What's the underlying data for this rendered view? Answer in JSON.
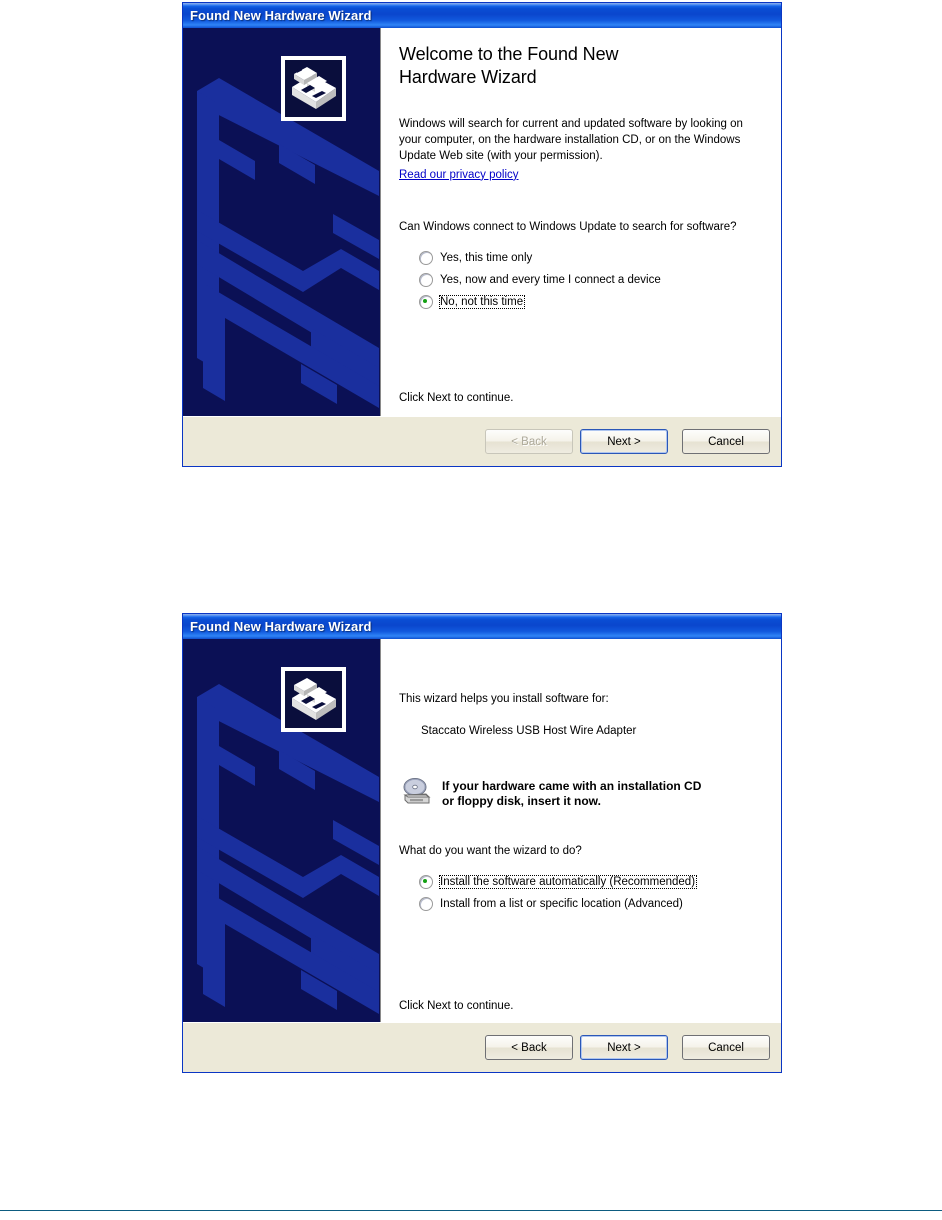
{
  "page": {
    "rule_color": "#0d5c80",
    "background": "#ffffff"
  },
  "dialogs": [
    {
      "id": "welcome-step",
      "title": "Found New Hardware Wizard",
      "icon": "hardware-device-icon",
      "heading": "Welcome to the Found New Hardware Wizard",
      "heading_line1": "Welcome to the Found New",
      "heading_line2": "Hardware Wizard",
      "intro": "Windows will search for current and updated software by looking on your computer, on the hardware installation CD, or on the Windows Update Web site (with your permission).",
      "privacy_link": "Read our privacy policy",
      "question": "Can Windows connect to Windows Update to search for software?",
      "options": [
        {
          "label": "Yes, this time only",
          "accel": "Y",
          "checked": false,
          "focused": false
        },
        {
          "label": "Yes, now and every time I connect a device",
          "accel": "e",
          "checked": false,
          "focused": false
        },
        {
          "label": "No, not this time",
          "accel": "N",
          "checked": true,
          "focused": true
        }
      ],
      "footer_note": "Click Next to continue.",
      "buttons": [
        {
          "label": "< Back",
          "accel": "B",
          "disabled": true,
          "default": false
        },
        {
          "label": "Next >",
          "accel": "N",
          "disabled": false,
          "default": true
        },
        {
          "label": "Cancel",
          "accel": "",
          "disabled": false,
          "default": false
        }
      ]
    },
    {
      "id": "install-step",
      "title": "Found New Hardware Wizard",
      "icon": "hardware-device-icon",
      "intro": "This wizard helps you install software for:",
      "device_name": "Staccato Wireless USB Host Wire Adapter",
      "cd_note_line1": "If your hardware came with an installation CD",
      "cd_note_line2": "or floppy disk, insert it now.",
      "cd_icon": "cd-drive-icon",
      "question": "What do you want the wizard to do?",
      "options": [
        {
          "label": "Install the software automatically (Recommended)",
          "accel": "I",
          "checked": true,
          "focused": true
        },
        {
          "label": "Install from a list or specific location (Advanced)",
          "accel": "s",
          "checked": false,
          "focused": false
        }
      ],
      "footer_note": "Click Next to continue.",
      "buttons": [
        {
          "label": "< Back",
          "accel": "B",
          "disabled": false,
          "default": false
        },
        {
          "label": "Next >",
          "accel": "N",
          "disabled": false,
          "default": true
        },
        {
          "label": "Cancel",
          "accel": "",
          "disabled": false,
          "default": false
        }
      ]
    }
  ],
  "colors": {
    "titlebar_blue": "#0a4ed4",
    "watermark_bg": "#0b1055",
    "watermark_fg": "#1a30a8",
    "footer_beige": "#ece9d8",
    "link_blue": "#0000c8",
    "radio_green": "#14a014",
    "dialog_border": "#0a36c4"
  }
}
